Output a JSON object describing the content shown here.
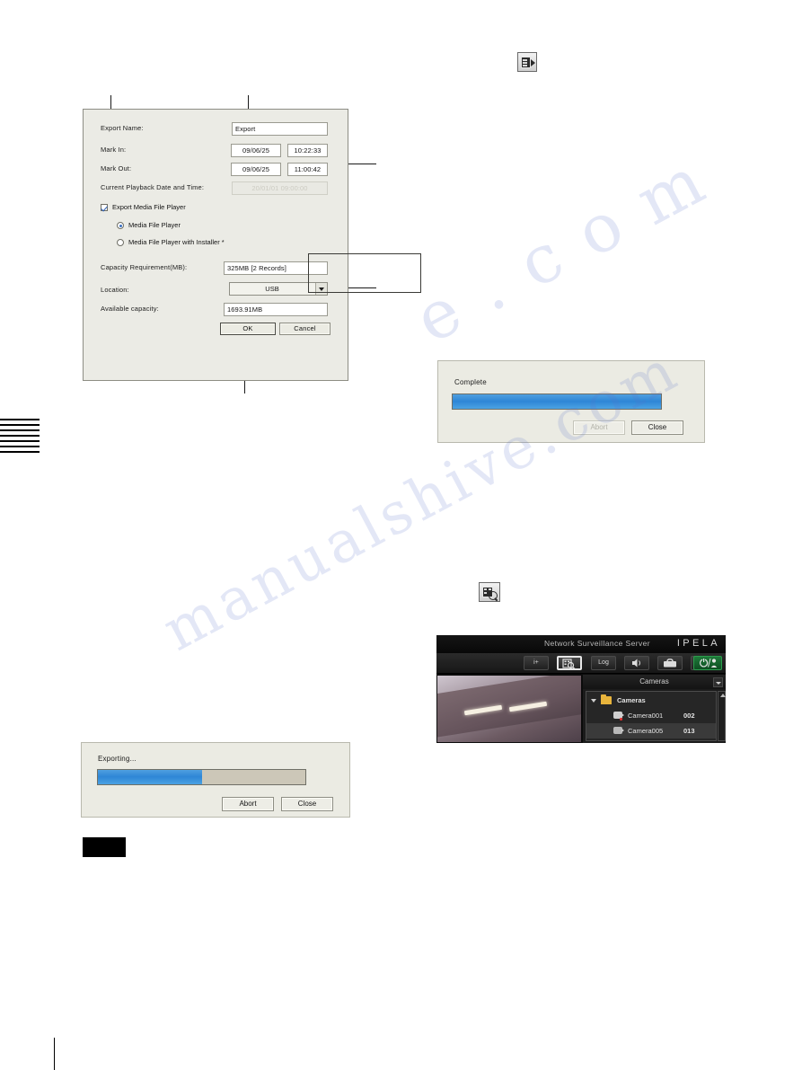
{
  "export_dialog": {
    "name": "Export Setting Dialog",
    "fields": {
      "export_name_label": "Export Name:",
      "export_name_value": "Export",
      "mark_in_label": "Mark In:",
      "mark_in_date": "09/06/25",
      "mark_in_time": "10:22:33",
      "mark_out_label": "Mark Out:",
      "mark_out_date": "09/06/25",
      "mark_out_time": "11:00:42",
      "playback_label": "Current Playback Date and Time:",
      "playback_value": "20/01/01 09:00:00",
      "export_player_checkbox_label": "Export Media File Player",
      "radio_player_label": "Media File Player",
      "radio_player_installer_label": "Media File Player with Installer *",
      "capacity_label": "Capacity Requirement(MB):",
      "capacity_value": "325MB [2 Records]",
      "location_label": "Location:",
      "location_value": "USB",
      "available_label": "Available capacity:",
      "available_value": "1693.91MB"
    },
    "buttons": {
      "ok": "OK",
      "cancel": "Cancel"
    }
  },
  "exporting_dialog": {
    "title": "Exporting...",
    "progress_percent": 50,
    "abort": "Abort",
    "close": "Close"
  },
  "complete_dialog": {
    "title": "Complete",
    "progress_percent": 100,
    "abort": "Abort",
    "close": "Close"
  },
  "surveillance": {
    "header_title": "Network Surveillance Server",
    "brand": "IPELA",
    "toolbar": [
      {
        "id": "info-button",
        "label": "i+"
      },
      {
        "id": "search-button",
        "label": ""
      },
      {
        "id": "log-button",
        "label": "Log"
      },
      {
        "id": "audio-button",
        "label": ""
      },
      {
        "id": "tools-button",
        "label": ""
      },
      {
        "id": "window-button",
        "label": ""
      },
      {
        "id": "power-button",
        "label": ""
      }
    ],
    "tree_header": "Cameras",
    "tree": {
      "root_label": "Cameras",
      "items": [
        {
          "label": "Camera001",
          "number": "002"
        },
        {
          "label": "Camera005",
          "number": "013"
        }
      ]
    }
  },
  "watermark": {
    "line1": "manualshive.com",
    "line2": "e . c o m"
  },
  "colors": {
    "dialog_bg": "#ebebe5",
    "progress_fill": "#2e86d6",
    "progress_track": "#ccc7b8",
    "accent_green": "#1f7a3a"
  }
}
